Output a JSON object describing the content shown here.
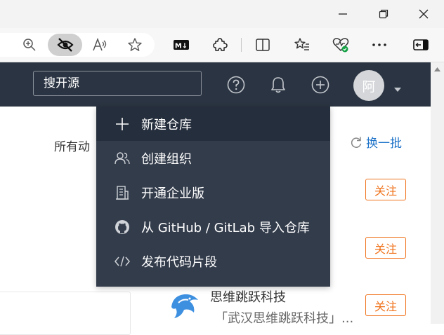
{
  "site": {
    "search_placeholder": "搜开源",
    "avatar_text": "阿"
  },
  "page": {
    "section_label": "所有动",
    "refresh_label": "换一批",
    "follow_label": "关注",
    "org": {
      "name": "思维跳跃科技",
      "description": "「武汉思维跳跃科技」..."
    }
  },
  "dropdown": {
    "items": [
      {
        "label": "新建仓库",
        "icon": "plus-icon"
      },
      {
        "label": "创建组织",
        "icon": "users-icon"
      },
      {
        "label": "开通企业版",
        "icon": "building-icon"
      },
      {
        "label": "从 GitHub / GitLab 导入仓库",
        "icon": "github-icon"
      },
      {
        "label": "发布代码片段",
        "icon": "code-icon"
      }
    ]
  },
  "toolbar": {
    "icons": [
      "zoom-icon",
      "eye-slash-icon",
      "read-aloud-icon",
      "favorite-star-icon",
      "markdown-icon",
      "extensions-icon",
      "split-screen-icon",
      "favorites-icon",
      "browser-health-icon",
      "more-icon",
      "sidebar-icon"
    ]
  },
  "colors": {
    "header_bg": "#2b3442",
    "dropdown_bg": "#333c4b",
    "dropdown_active": "#252e3c",
    "follow_orange": "#f0731c",
    "link_blue": "#1e73c8"
  }
}
